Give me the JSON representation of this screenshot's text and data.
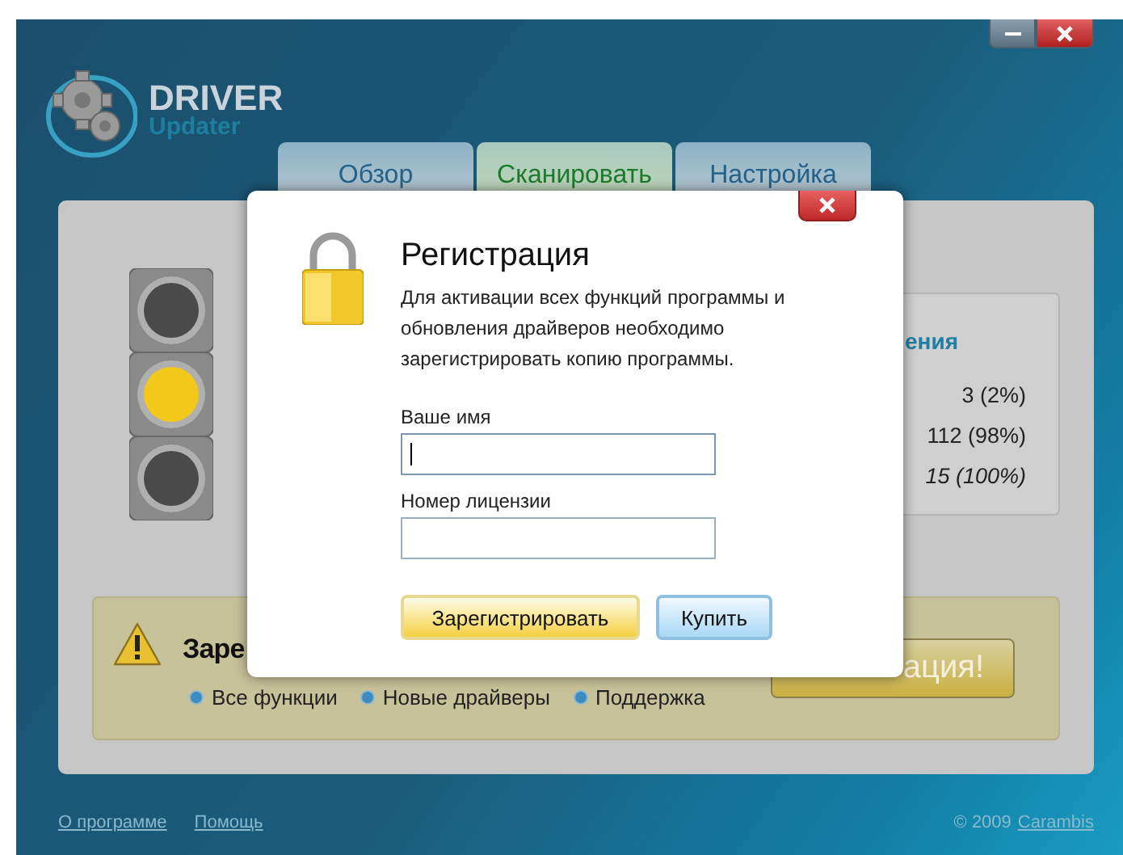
{
  "logo": {
    "title": "DRIVER",
    "subtitle": "Updater"
  },
  "tabs": [
    {
      "label": "Обзор",
      "selected": false
    },
    {
      "label": "Сканировать",
      "selected": true
    },
    {
      "label": "Настройка",
      "selected": false
    }
  ],
  "traffic_light": [
    {
      "on": false
    },
    {
      "on": true
    },
    {
      "on": false
    }
  ],
  "stats": {
    "heading": "ения",
    "rows": [
      {
        "value": "3 (2%)",
        "kind": "count"
      },
      {
        "value": "112 (98%)",
        "kind": "count"
      },
      {
        "value": "15 (100%)",
        "kind": "total"
      }
    ]
  },
  "warning": {
    "title": "Заре",
    "features": [
      "Все функции",
      "Новые драйверы",
      "Поддержка"
    ],
    "button": "ация!"
  },
  "dialog": {
    "title": "Регистрация",
    "text": "Для активации всех функций программы и обновления драйверов необходимо зарегистрировать копию программы.",
    "fields": [
      {
        "label": "Ваше имя",
        "focused": true
      },
      {
        "label": "Номер лицензии",
        "focused": false
      }
    ],
    "buttons": [
      {
        "label": "Зарегистрировать",
        "kind": "primary"
      },
      {
        "label": "Купить",
        "kind": "secondary"
      }
    ]
  },
  "footer": {
    "links": [
      "О программе",
      "Помощь"
    ],
    "copyright": "© 2009",
    "brand": "Carambis"
  }
}
